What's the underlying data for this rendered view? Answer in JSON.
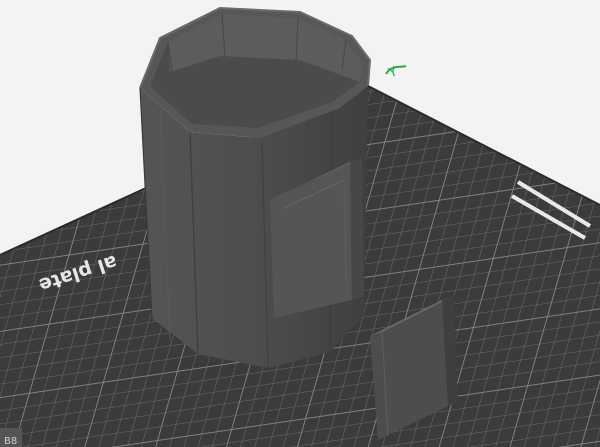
{
  "viewport": {
    "plate_label": "al plate",
    "corner_label": "B8",
    "axis_label": "Y"
  },
  "colors": {
    "background": "#f3f3f3",
    "plate": "#3b3b3b",
    "grid": "#6e6e6e",
    "model_dark": "#4a4a4a",
    "model_light": "#626262",
    "axis_y": "#21b04a"
  }
}
